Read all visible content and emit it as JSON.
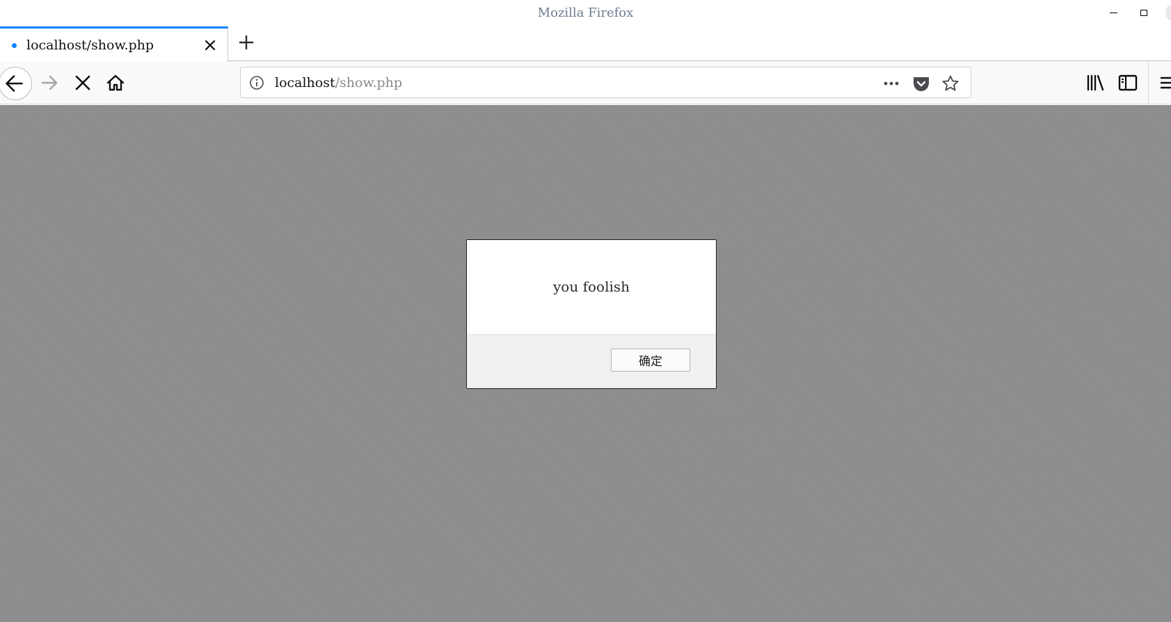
{
  "window": {
    "title": "Mozilla Firefox",
    "controls": {
      "minimize_icon": "minimize-icon",
      "maximize_icon": "maximize-icon"
    }
  },
  "tabs": [
    {
      "label": "localhost/show.php",
      "active": true,
      "loading": true
    }
  ],
  "nav": {
    "icons": {
      "back": "back-arrow-icon",
      "forward": "forward-arrow-icon",
      "stop": "stop-icon",
      "home": "home-icon",
      "info": "info-icon",
      "more": "more-horizontal-icon",
      "pocket": "pocket-icon",
      "bookmark": "star-icon",
      "library": "library-icon",
      "sidebar": "sidebar-icon",
      "menu": "hamburger-menu-icon"
    },
    "url": {
      "host": "localhost",
      "path": "/show.php"
    }
  },
  "dialog": {
    "message": "you foolish",
    "ok_label": "确定"
  },
  "colors": {
    "accent": "#0a84ff",
    "overlay": "#8d8e90",
    "title_text": "#6b7b8f"
  }
}
